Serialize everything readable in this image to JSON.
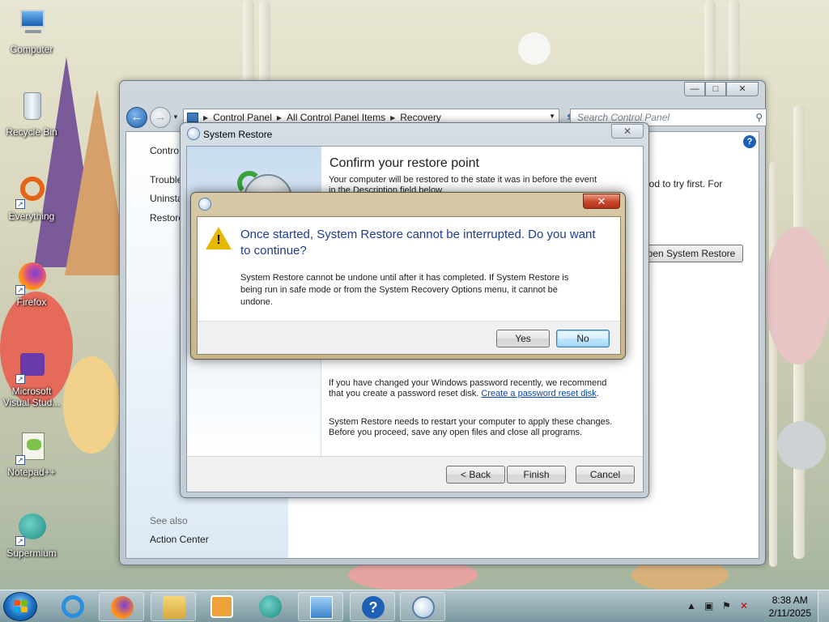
{
  "desktop": {
    "icons": [
      {
        "label": "Computer",
        "icon": "computer-icon"
      },
      {
        "label": "Recycle Bin",
        "icon": "recycle-bin-icon"
      },
      {
        "label": "Everything",
        "icon": "everything-icon"
      },
      {
        "label": "Firefox",
        "icon": "firefox-icon"
      },
      {
        "label": "Microsoft Visual Stud...",
        "icon": "visual-studio-icon"
      },
      {
        "label": "Notepad++",
        "icon": "notepadpp-icon"
      },
      {
        "label": "Supermium",
        "icon": "supermium-icon"
      }
    ]
  },
  "control_panel": {
    "address": {
      "segments": [
        "Control Panel",
        "All Control Panel Items",
        "Recovery"
      ]
    },
    "search_placeholder": "Search Control Panel",
    "left_links": [
      "Contro",
      "Trouble",
      "Uninsta",
      "Restore"
    ],
    "see_also_label": "See also",
    "see_also_link": "Action Center",
    "main_text_fragment": "hod to try first. For",
    "open_system_restore_label": "pen System Restore",
    "caption_buttons": {
      "minimize": "—",
      "maximize": "□",
      "close": "✕"
    }
  },
  "system_restore": {
    "title": "System Restore",
    "heading": "Confirm your restore point",
    "intro_line1": "Your computer will be restored to the state it was in before the event",
    "intro_line2": "in the Description field below.",
    "password_text": "If you have changed your Windows password recently, we recommend that you create a password reset disk.",
    "password_prefix": "If you have changed your Windows password recently, we recommend",
    "password_prefix2": "that you create a password reset disk.",
    "password_link": "Create a password reset disk",
    "restart_line1": "System Restore needs to restart your computer to apply these changes.",
    "restart_line2": "Before you proceed, save any open files and close all programs.",
    "back_label": "< Back",
    "finish_label": "Finish",
    "cancel_label": "Cancel",
    "close_glyph": "✕"
  },
  "confirm_dialog": {
    "message_line1": "Once started, System Restore cannot be interrupted. Do you want",
    "message_line2": "to continue?",
    "detail_line1": "System Restore cannot be undone until after it has completed. If System Restore is",
    "detail_line2": "being run in safe mode or from the System Recovery Options menu, it cannot be",
    "detail_line3": "undone.",
    "yes_label": "Yes",
    "no_label": "No",
    "close_glyph": "✕",
    "warning_glyph": "!"
  },
  "taskbar": {
    "pinned": [
      "internet-explorer-icon",
      "firefox-icon",
      "file-explorer-icon",
      "media-player-icon",
      "supermium-icon",
      "control-panel-icon",
      "help-icon",
      "system-restore-icon"
    ],
    "clock_time": "8:38 AM",
    "clock_date": "2/11/2025",
    "tray_expand": "▲"
  },
  "colors": {
    "dialog_heading": "#1f3d8f",
    "link": "#0645ad",
    "warning": "#e6b800",
    "close_red": "#c8452a"
  }
}
